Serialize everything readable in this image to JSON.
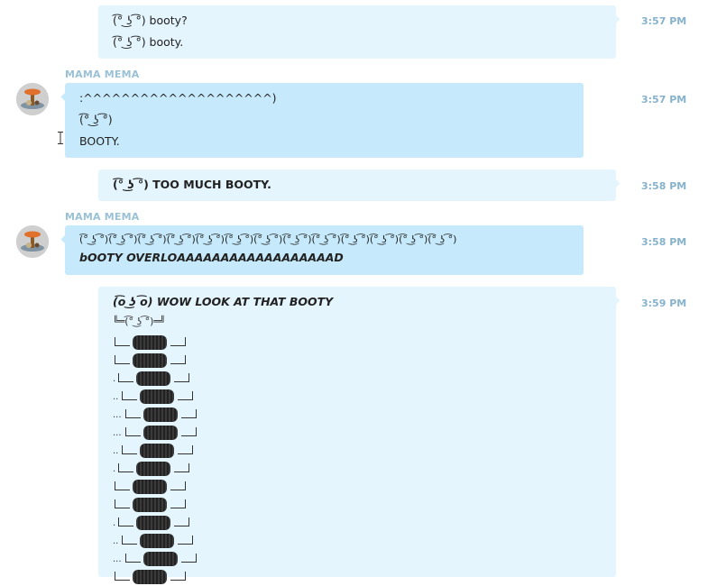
{
  "messages": [
    {
      "id": "m1",
      "lines": [
        "(͡° ͜ʖ ͡°) booty?",
        "(͡° ͜ʖ ͡°) booty."
      ],
      "time": "3:57 PM"
    },
    {
      "id": "m2",
      "sender": "MAMA MEMA",
      "lines": [
        ":^^^^^^^^^^^^^^^^^^^^)",
        "(͡° ͜ʖ ͡°)",
        "BOOTY."
      ],
      "time": "3:57 PM"
    },
    {
      "id": "m3",
      "lines": [
        "(͡° ͜ʖ ͡°) TOO MUCH BOOTY."
      ],
      "time": "3:58 PM"
    },
    {
      "id": "m4",
      "sender": "MAMA MEMA",
      "lines": [
        "(͡° ͜ʖ ͡°)(͡° ͜ʖ ͡°)(͡° ͜ʖ ͡°)(͡° ͜ʖ ͡°)(͡° ͜ʖ ͡°)(͡° ͜ʖ ͡°)(͡° ͜ʖ ͡°)(͡° ͜ʖ ͡°)(͡° ͜ʖ ͡°)(͡° ͜ʖ ͡°)(͡° ͜ʖ ͡°)(͡° ͜ʖ ͡°)(͡° ͜ʖ ͡°)",
        "bOOTY OVERLOAAAAAAAAAAAAAAAAAAD"
      ],
      "time": "3:58 PM"
    },
    {
      "id": "m5",
      "lines": [
        "(͡o ͜ʖ ͡o) WOW LOOK AT THAT BOOTY"
      ],
      "ladder_head": "╚═(͡° ͜ʖ ͡°)═╝",
      "ladder_prefixes": [
        "",
        "",
        ".",
        "..",
        "...",
        "...",
        "..",
        ".",
        "",
        "",
        ".",
        "..",
        "...",
        ""
      ],
      "time": "3:59 PM"
    }
  ],
  "icons": {
    "avatar": "avatar-mama-mema",
    "cursor": "text-cursor-icon"
  },
  "colors": {
    "sent": "#e4f5fd",
    "received": "#c6eafb",
    "time": "#86b2cc",
    "sender": "#9ac1d6"
  }
}
